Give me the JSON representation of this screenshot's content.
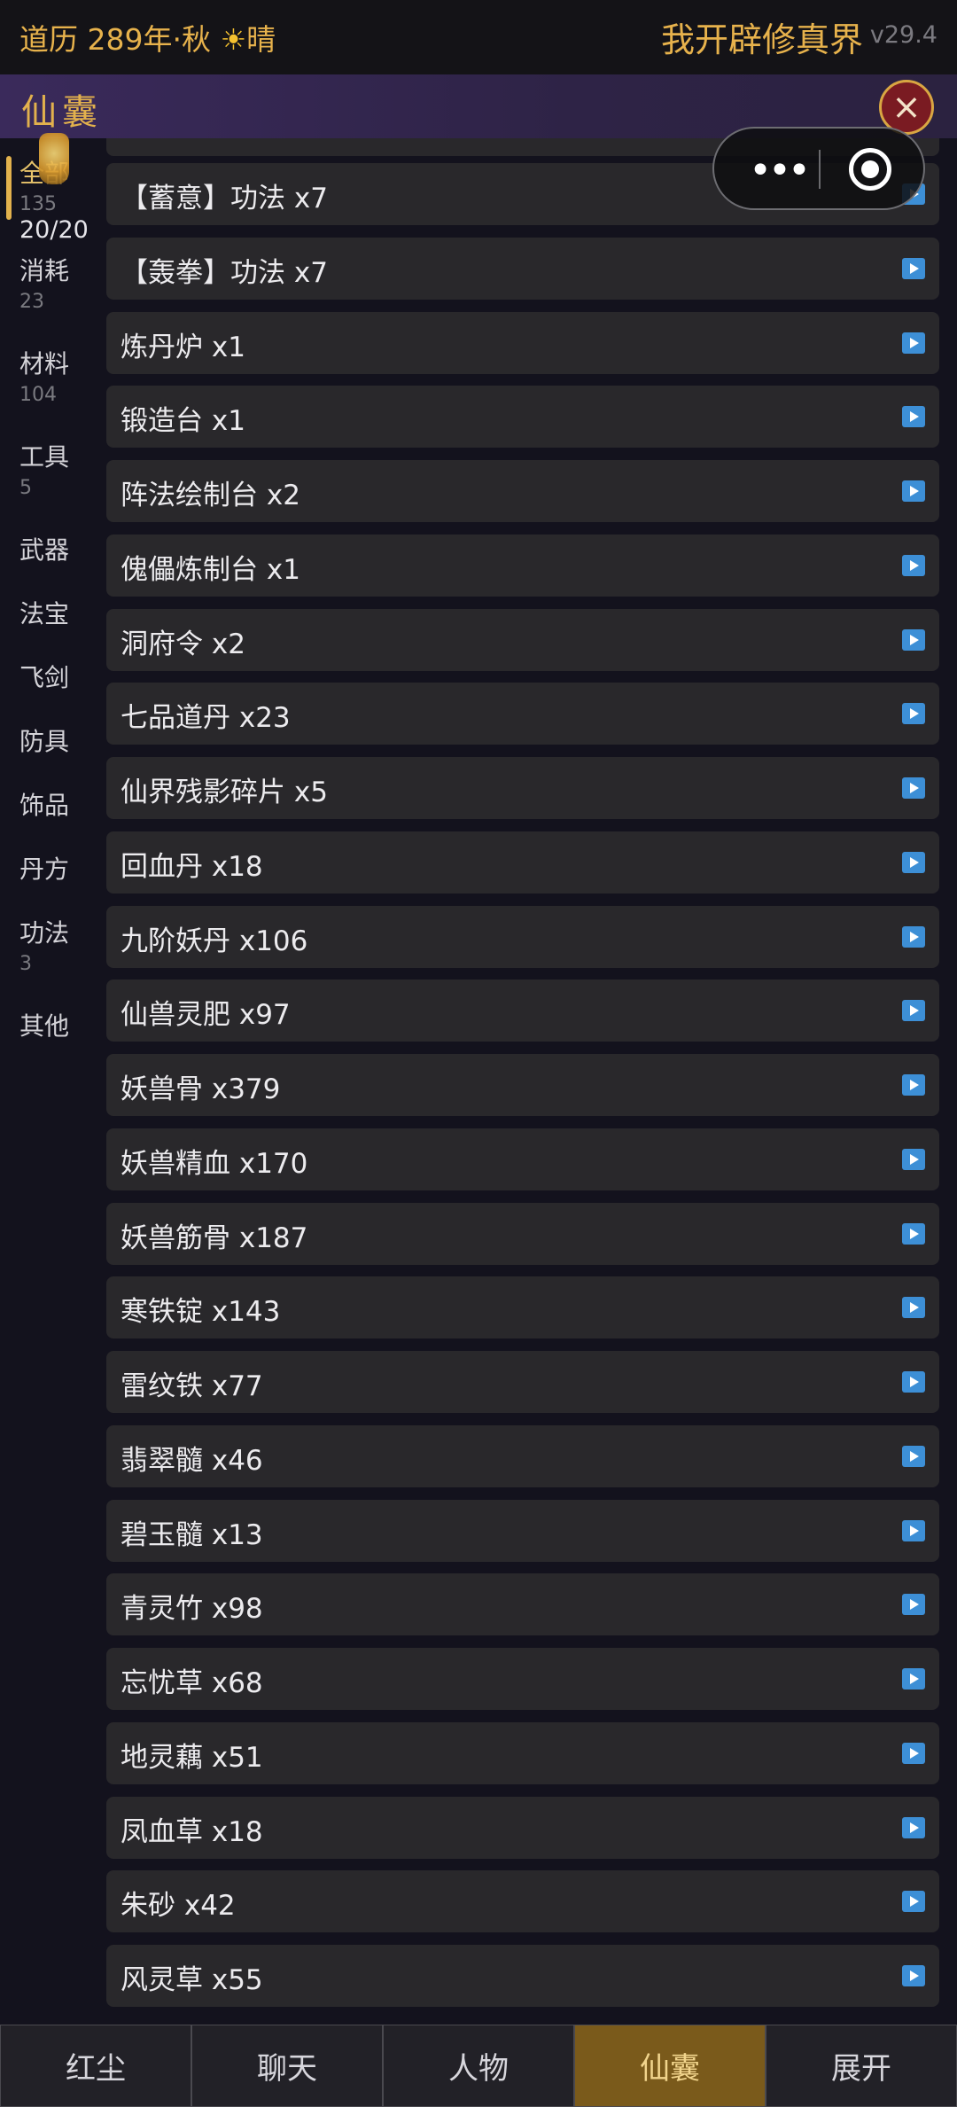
{
  "status": {
    "date": "道历 289年·秋",
    "weather_icon": "☀",
    "weather": "晴",
    "app_title": "我开辟修真界",
    "version": "v29.4"
  },
  "panel": {
    "title": "仙囊",
    "close_icon": "×",
    "capsule_more": "•••"
  },
  "sidebar": {
    "capacity": "20/20",
    "items": [
      {
        "label": "全部",
        "count": "135"
      },
      {
        "label": "消耗",
        "count": "23"
      },
      {
        "label": "材料",
        "count": "104"
      },
      {
        "label": "工具",
        "count": "5"
      },
      {
        "label": "武器",
        "count": ""
      },
      {
        "label": "法宝",
        "count": ""
      },
      {
        "label": "飞剑",
        "count": ""
      },
      {
        "label": "防具",
        "count": ""
      },
      {
        "label": "饰品",
        "count": ""
      },
      {
        "label": "丹方",
        "count": ""
      },
      {
        "label": "功法",
        "count": "3"
      },
      {
        "label": "其他",
        "count": ""
      }
    ]
  },
  "items": [
    "【蓄意】功法 x7",
    "【轰拳】功法 x7",
    "炼丹炉 x1",
    "锻造台 x1",
    "阵法绘制台 x2",
    "傀儡炼制台 x1",
    "洞府令 x2",
    "七品道丹 x23",
    "仙界残影碎片 x5",
    "回血丹 x18",
    "九阶妖丹 x106",
    "仙兽灵肥 x97",
    "妖兽骨 x379",
    "妖兽精血 x170",
    "妖兽筋骨 x187",
    "寒铁锭 x143",
    "雷纹铁 x77",
    "翡翠髓 x46",
    "碧玉髓 x13",
    "青灵竹 x98",
    "忘忧草 x68",
    "地灵藕 x51",
    "凤血草 x18",
    "朱砂 x42",
    "风灵草 x55"
  ],
  "tabs": [
    {
      "label": "红尘",
      "active": false
    },
    {
      "label": "聊天",
      "active": false
    },
    {
      "label": "人物",
      "active": false
    },
    {
      "label": "仙囊",
      "active": true
    },
    {
      "label": "展开",
      "active": false
    }
  ],
  "colors": {
    "accent_gold": "#e2b14d",
    "active_tab": "#7a5a1b",
    "play_icon": "#3d8fd6"
  }
}
